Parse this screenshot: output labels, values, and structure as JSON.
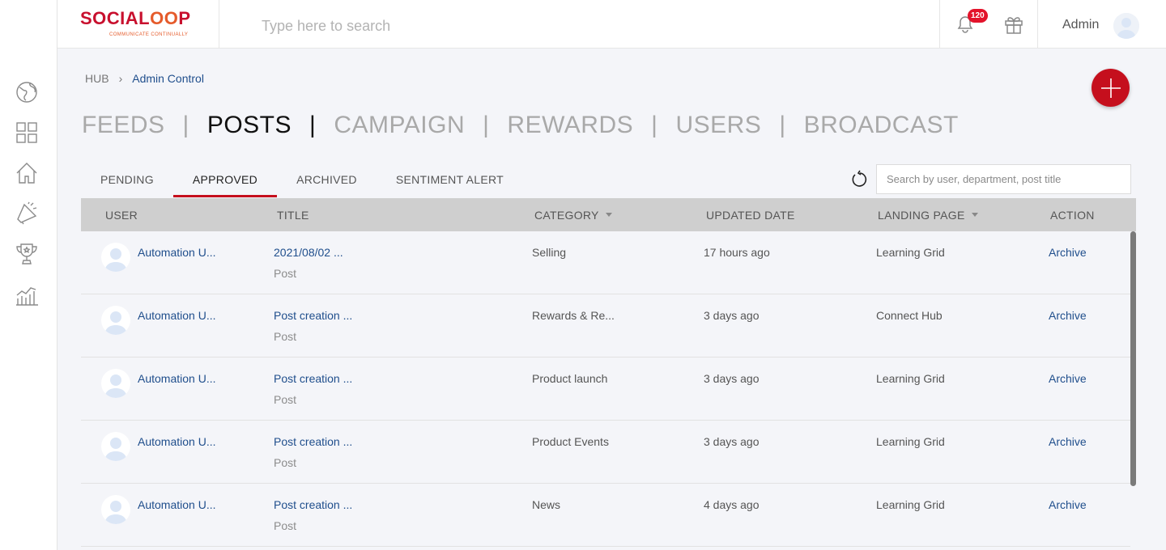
{
  "brand": {
    "logo_left": "SOCIAL",
    "logo_mid": "OO",
    "logo_right": "P",
    "tagline": "COMMUNICATE CONTINUALLY"
  },
  "header": {
    "search_placeholder": "Type here to search",
    "notification_count": "120",
    "admin_label": "Admin"
  },
  "breadcrumb": {
    "root": "HUB",
    "separator": "›",
    "current": "Admin Control"
  },
  "main_nav": [
    {
      "label": "FEEDS",
      "active": false
    },
    {
      "label": "POSTS",
      "active": true
    },
    {
      "label": "CAMPAIGN",
      "active": false
    },
    {
      "label": "REWARDS",
      "active": false
    },
    {
      "label": "USERS",
      "active": false
    },
    {
      "label": "BROADCAST",
      "active": false
    }
  ],
  "sub_tabs": [
    {
      "label": "PENDING",
      "active": false
    },
    {
      "label": "APPROVED",
      "active": true
    },
    {
      "label": "ARCHIVED",
      "active": false
    },
    {
      "label": "SENTIMENT ALERT",
      "active": false
    }
  ],
  "table_search_placeholder": "Search by user, department, post title",
  "table": {
    "columns": [
      "USER",
      "TITLE",
      "CATEGORY",
      "UPDATED DATE",
      "LANDING PAGE",
      "ACTION"
    ],
    "rows": [
      {
        "user": "Automation U...",
        "title": "2021/08/02 ...",
        "type": "Post",
        "category": "Selling",
        "updated": "17 hours ago",
        "landing": "Learning Grid",
        "action": "Archive"
      },
      {
        "user": "Automation U...",
        "title": "Post creation ...",
        "type": "Post",
        "category": "Rewards & Re...",
        "updated": "3 days ago",
        "landing": "Connect Hub",
        "action": "Archive"
      },
      {
        "user": "Automation U...",
        "title": "Post creation ...",
        "type": "Post",
        "category": "Product launch",
        "updated": "3 days ago",
        "landing": "Learning Grid",
        "action": "Archive"
      },
      {
        "user": "Automation U...",
        "title": "Post creation ...",
        "type": "Post",
        "category": "Product Events",
        "updated": "3 days ago",
        "landing": "Learning Grid",
        "action": "Archive"
      },
      {
        "user": "Automation U...",
        "title": "Post creation ...",
        "type": "Post",
        "category": "News",
        "updated": "4 days ago",
        "landing": "Learning Grid",
        "action": "Archive"
      }
    ]
  },
  "sidebar_icons": [
    "globe-icon",
    "grid-icon",
    "home-icon",
    "megaphone-icon",
    "trophy-icon",
    "analytics-icon"
  ],
  "colors": {
    "accent": "#c50f1d",
    "link": "#1f4e8c",
    "header_bg": "#cfcfcf",
    "page_bg": "#f4f5f9"
  }
}
